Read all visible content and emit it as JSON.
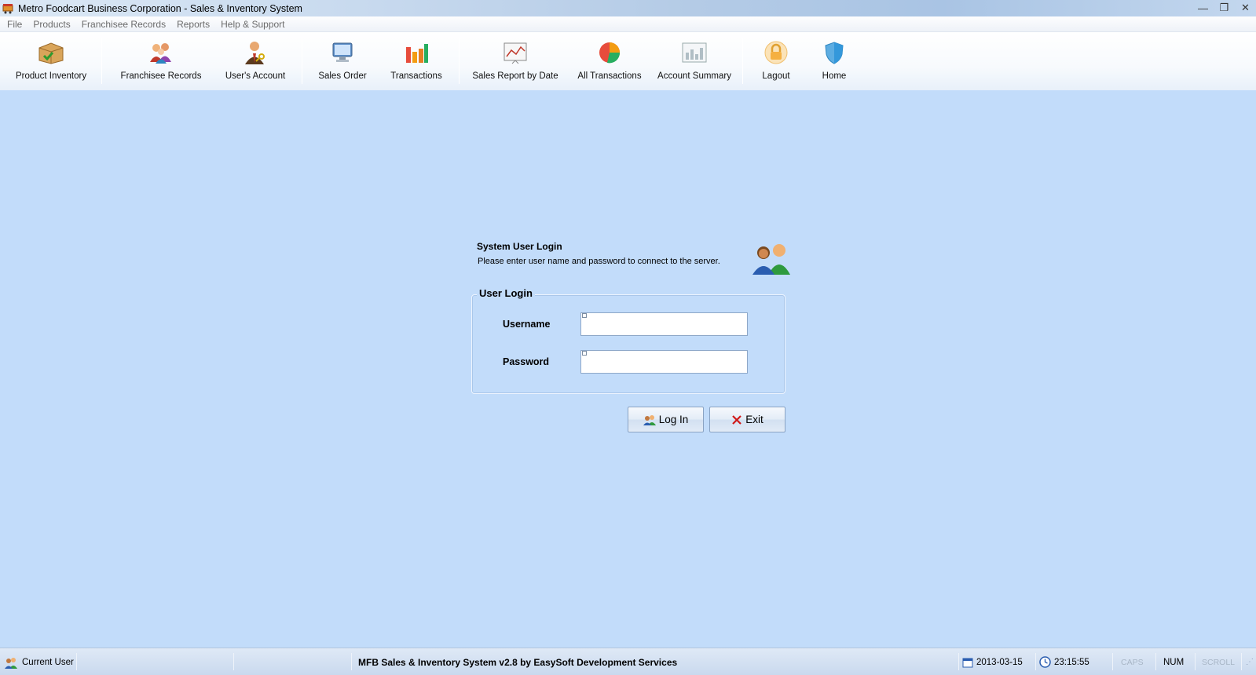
{
  "window": {
    "title": "Metro Foodcart Business Corporation - Sales & Inventory System",
    "minimize": "—",
    "restore": "❐",
    "close": "✕"
  },
  "menu": [
    "File",
    "Products",
    "Franchisee Records",
    "Reports",
    "Help & Support"
  ],
  "toolbar": {
    "product_inventory": "Product Inventory",
    "franchisee_records": "Franchisee Records",
    "users_account": "User's Account",
    "sales_order": "Sales Order",
    "transactions": "Transactions",
    "sales_report_by_date": "Sales Report by Date",
    "all_transactions": "All Transactions",
    "account_summary": "Account Summary",
    "logout": "Lagout",
    "home": "Home"
  },
  "login": {
    "title": "System User Login",
    "subtitle": "Please enter user name and password to connect to the server.",
    "group_title": "User Login",
    "username_label": "Username",
    "username_value": "",
    "password_label": "Password",
    "password_value": "",
    "login_button": "Log In",
    "exit_button": "Exit"
  },
  "status": {
    "current_user": "Current User",
    "app_info": "MFB Sales & Inventory System v2.8  by EasySoft Development Services",
    "date": "2013-03-15",
    "time": "23:15:55",
    "caps": "CAPS",
    "num": "NUM",
    "scroll": "SCROLL"
  },
  "icons": {
    "app": "food-cart-icon",
    "product_inventory": "box-icon",
    "franchisee_records": "people-icon",
    "users_account": "user-key-icon",
    "sales_order": "monitor-icon",
    "transactions": "bar-chart-icon",
    "sales_report_by_date": "line-chart-icon",
    "all_transactions": "pie-chart-icon",
    "account_summary": "table-chart-icon",
    "logout": "lock-icon",
    "home": "shield-icon",
    "login_header": "users-icon",
    "login_button": "users-icon",
    "exit_button": "x-icon",
    "calendar": "calendar-icon",
    "clock": "clock-icon"
  }
}
